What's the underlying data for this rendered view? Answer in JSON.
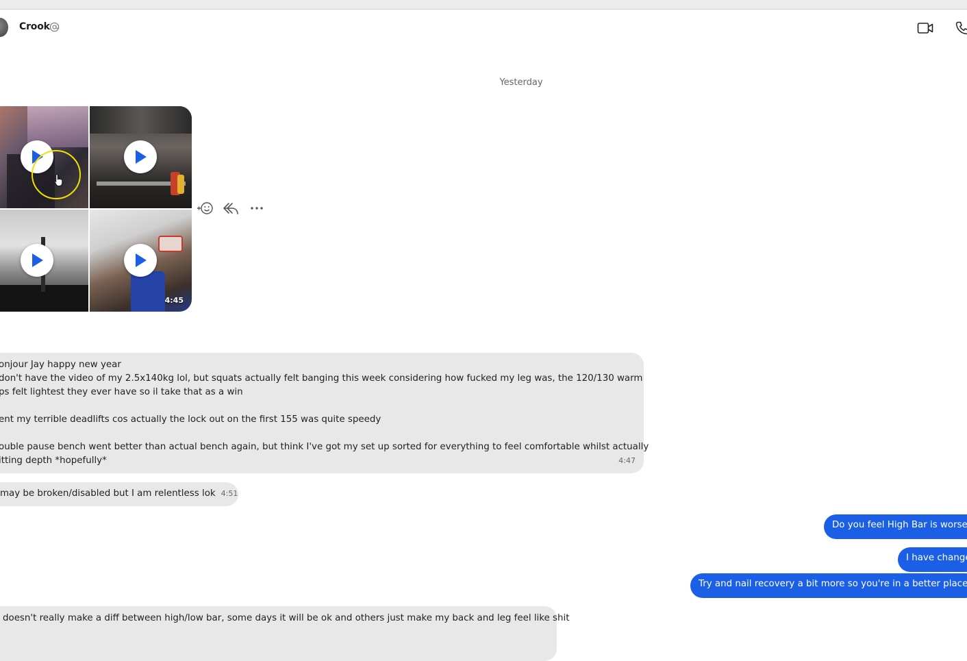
{
  "header": {
    "contact_name": "Crook",
    "icons": [
      "at-icon",
      "video-call-icon",
      "phone-icon"
    ]
  },
  "conversation": {
    "day_separator": "Yesterday",
    "media_message": {
      "video_duration": "4:45",
      "actions": [
        "add-reaction-icon",
        "reply-icon",
        "more-icon"
      ]
    },
    "incoming_long": {
      "lines": [
        "onjour Jay happy new year",
        "don't have the video of my 2.5x140kg lol, but squats actually felt banging this week considering how fucked my leg was, the 120/130 warm",
        "ps felt lightest they ever have so il take that as a win",
        "",
        "ent my terrible deadlifts cos actually the lock out on the first 155 was quite speedy",
        "",
        "ouble pause bench went better than actual bench again, but think I've got my set up sorted for everything to feel comfortable whilst actually",
        "itting depth *hopefully*"
      ],
      "time": "4:47"
    },
    "incoming_short": {
      "text": "may be broken/disabled but I am relentless lok",
      "time": "4:51"
    },
    "outgoing": [
      "Do you feel High Bar is worse",
      "I have change",
      "Try and nail recovery a bit more so you're in a better place n"
    ],
    "incoming_bottom": {
      "text": "doesn't really make a diff between high/low bar, some days it will be ok and others just make my back and leg feel like shit"
    }
  },
  "colors": {
    "outgoing_bubble": "#1b5fe6",
    "incoming_bubble": "#e8e8e8",
    "cursor_highlight": "#f0e000"
  }
}
